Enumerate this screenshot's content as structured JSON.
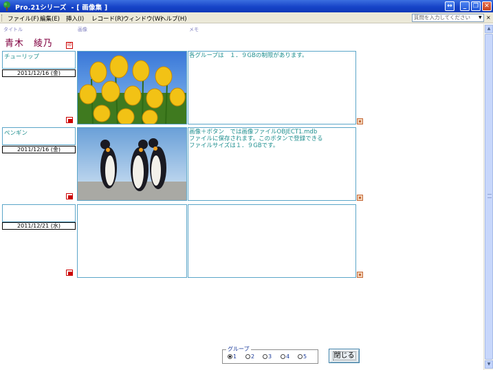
{
  "window": {
    "title": "Pro.21シリーズ  - [ 画像集 ]",
    "controls": [
      "restore",
      "minimize",
      "maximize",
      "close"
    ]
  },
  "menu": {
    "items": [
      "ファイル(F)",
      "編集(E)",
      "挿入(I)",
      "レコード(R)",
      "ウィンドウ(W)",
      "ヘルプ(H)"
    ],
    "ask_placeholder": "質問を入力してください"
  },
  "headers": {
    "title": "タイトル",
    "image": "画像",
    "memo": "メモ"
  },
  "owner": {
    "name": "青木　綾乃",
    "print_label": "印"
  },
  "records": [
    {
      "title": "チューリップ",
      "date": "2011/12/16 (金)",
      "image": "tulip-photo",
      "memo": "各グループは　１．９GBの制限があります。"
    },
    {
      "title": "ペンギン",
      "date": "2011/12/16 (金)",
      "image": "penguin-photo",
      "memo": "画像＋ボタン　では画像ファイルOBJECT1.mdb\nファイルに保存されます。このボタンで登録できる\nファイルサイズは１．９GBです。"
    },
    {
      "title": "",
      "date": "2011/12/21 (水)",
      "image": "",
      "memo": ""
    }
  ],
  "group": {
    "label": "グループ",
    "options": [
      "1",
      "2",
      "3",
      "4",
      "5"
    ],
    "selected": "1"
  },
  "close_button": "閉じる",
  "colors": {
    "titlebar": "#1744c8",
    "field_border": "#5aa5c8",
    "field_text": "#1f8f8f",
    "owner_text": "#800040"
  }
}
